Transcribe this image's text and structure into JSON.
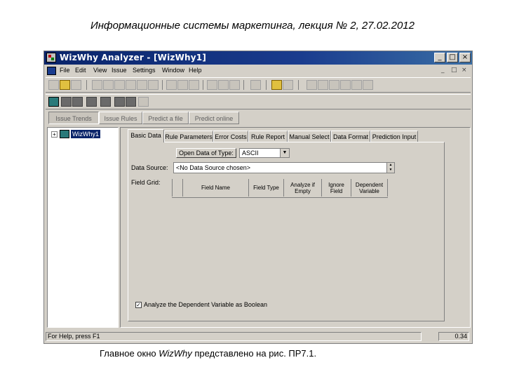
{
  "slide": {
    "title": "Информационные системы маркетинга, лекция № 2, 27.02.2012",
    "caption_pre": "Главное окно ",
    "caption_italic": "WizWhy",
    "caption_post": " представлено на рис. ПР7.1."
  },
  "window": {
    "title": "WizWhy Analyzer - [WizWhy1]",
    "controls": [
      "_",
      "□",
      "×"
    ],
    "mdi_controls": [
      "_",
      "□",
      "×"
    ]
  },
  "menu": [
    "File",
    "Edit",
    "View",
    "Issue",
    "Settings",
    "Window",
    "Help"
  ],
  "top_tabs": [
    "Issue Trends",
    "Issue Rules",
    "Predict a file",
    "Predict online"
  ],
  "tree": {
    "root_label": "WizWhy1"
  },
  "panel_tabs": [
    "Basic Data",
    "Rule Parameters",
    "Error Costs",
    "Rule Report",
    "Manual Select",
    "Data Format",
    "Prediction Input"
  ],
  "basic_data": {
    "open_button": "Open Data of Type:",
    "data_type": "ASCII",
    "data_source_label": "Data Source:",
    "data_source_value": "<No Data Source chosen>",
    "field_grid_label": "Field Grid:",
    "grid_columns": [
      "Field Name",
      "Field Type",
      "Analyze if Empty",
      "Ignore Field",
      "Dependent Variable"
    ],
    "checkbox_label": "Analyze the Dependent Variable as Boolean",
    "checkbox_checked": true
  },
  "status": {
    "help_text": "For Help, press F1",
    "value": "0.34"
  }
}
